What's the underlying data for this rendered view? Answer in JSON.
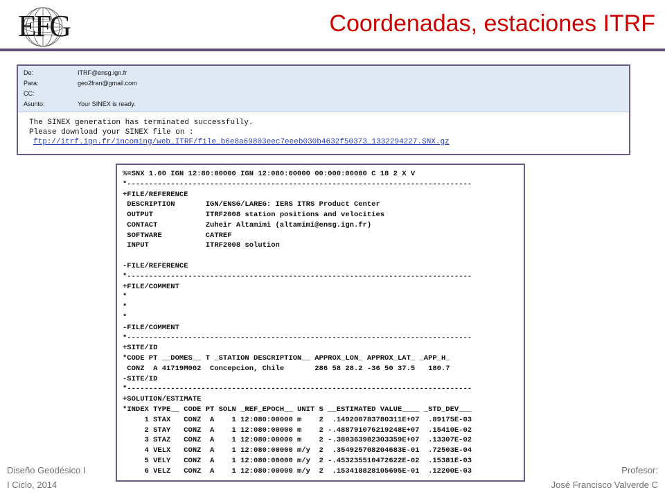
{
  "header": {
    "logo_text": "EFG",
    "title": "Coordenadas, estaciones ITRF",
    "colors": {
      "title": "#cc0000",
      "rule": "#5d4f77"
    }
  },
  "email": {
    "fields": [
      {
        "label": "De:",
        "value": "ITRF@ensg.ign.fr"
      },
      {
        "label": "Para:",
        "value": "geo2fran@gmail.com"
      },
      {
        "label": "CC:",
        "value": ""
      },
      {
        "label": "Asunto:",
        "value": "Your SINEX is ready."
      }
    ],
    "body_lines": [
      "The SINEX generation has terminated successfully.",
      "Please download your SINEX file on :"
    ],
    "link": "ftp://itrf.ign.fr/incoming/web_ITRF/file_b6e8a69803eec7eeeb030b4632f50373_1332294227.SNX.gz"
  },
  "sinex": {
    "lines": [
      "%=SNX 1.00 IGN 12:80:00000 IGN 12:080:00000 00:000:00000 C 18 2 X V",
      "*-------------------------------------------------------------------------------",
      "+FILE/REFERENCE",
      " DESCRIPTION       IGN/ENSG/LAREG: IERS ITRS Product Center",
      " OUTPUT            ITRF2008 station positions and velocities",
      " CONTACT           Zuheir Altamimi (altamimi@ensg.ign.fr)",
      " SOFTWARE          CATREF",
      " INPUT             ITRF2008 solution",
      "",
      "-FILE/REFERENCE",
      "*-------------------------------------------------------------------------------",
      "+FILE/COMMENT",
      "*",
      "*",
      "*",
      "-FILE/COMMENT",
      "*-------------------------------------------------------------------------------",
      "+SITE/ID",
      "*CODE PT __DOMES__ T _STATION DESCRIPTION__ APPROX_LON_ APPROX_LAT_ _APP_H_",
      " CONZ  A 41719M002  Concepcion, Chile       286 58 28.2 -36 50 37.5   180.7",
      "-SITE/ID",
      "*-------------------------------------------------------------------------------",
      "+SOLUTION/ESTIMATE",
      "*INDEX TYPE__ CODE PT SOLN _REF_EPOCH__ UNIT S __ESTIMATED VALUE____ _STD_DEV___",
      "     1 STAX   CONZ  A    1 12:080:00000 m    2  .149200783780311E+07  .89175E-03",
      "     2 STAY   CONZ  A    1 12:080:00000 m    2 -.488791076219248E+07  .15410E-02",
      "     3 STAZ   CONZ  A    1 12:080:00000 m    2 -.380363982303359E+07  .13307E-02",
      "     4 VELX   CONZ  A    1 12:080:00000 m/y  2  .354925708204683E-01  .72503E-04",
      "     5 VELY   CONZ  A    1 12:080:00000 m/y  2 -.453235510472622E-02  .15381E-03",
      "     6 VELZ   CONZ  A    1 12:080:00000 m/y  2  .153418828105695E-01  .12200E-03"
    ]
  },
  "footer": {
    "left_line1": "Diseño Geodésico I",
    "left_line2": "I Ciclo, 2014",
    "right_line1": "Profesor:",
    "right_line2": "José Francisco Valverde C"
  }
}
